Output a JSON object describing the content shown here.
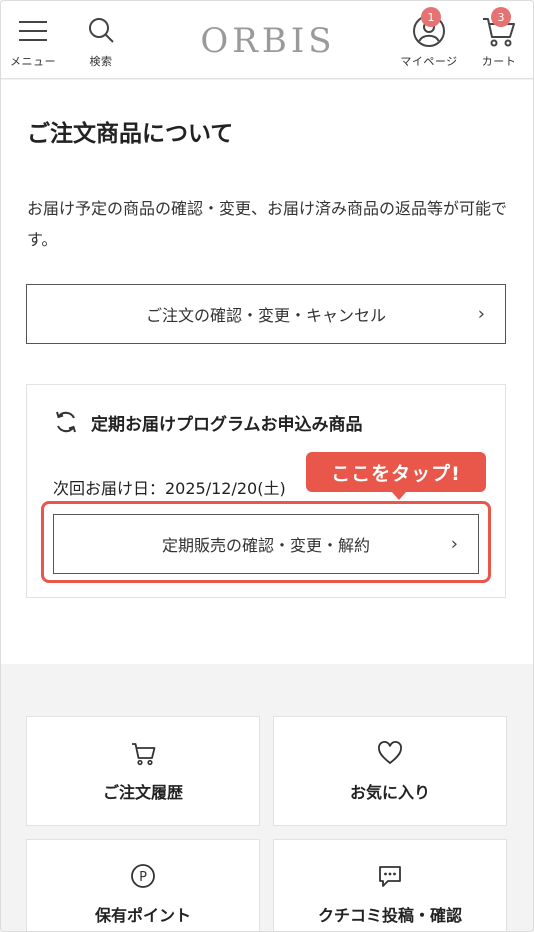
{
  "header": {
    "logo": "ORBIS",
    "menu_label": "メニュー",
    "search_label": "検索",
    "mypage_label": "マイページ",
    "mypage_badge": "1",
    "cart_label": "カート",
    "cart_badge": "3"
  },
  "main": {
    "title": "ご注文商品について",
    "description": "お届け予定の商品の確認・変更、お届け済み商品の返品等が可能です。",
    "order_button_label": "ご注文の確認・変更・キャンセル",
    "subscription": {
      "title": "定期お届けプログラムお申込み商品",
      "next_delivery": "次回お届け日：2025/12/20(土)",
      "button_label": "定期販売の確認・変更・解約"
    },
    "tooltip": "ここをタップ!"
  },
  "tiles": [
    {
      "label": "ご注文履歴",
      "icon": "cart-icon"
    },
    {
      "label": "お気に入り",
      "icon": "heart-icon"
    },
    {
      "label": "保有ポイント",
      "icon": "point-icon"
    },
    {
      "label": "クチコミ投稿・確認",
      "icon": "review-icon"
    }
  ],
  "colors": {
    "accent": "#e8574a",
    "badge": "#e57373",
    "logo": "#9a9a9a"
  }
}
